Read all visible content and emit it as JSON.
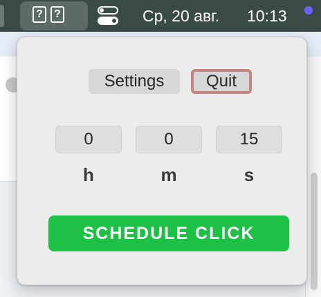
{
  "menubar": {
    "app_icon_glyph": "?",
    "date": "Ср, 20 авг.",
    "time": "10:13",
    "control_center_icon": "toggle-switches-icon",
    "notification_dot_color": "#6b63ff"
  },
  "popover": {
    "settings_label": "Settings",
    "quit_label": "Quit",
    "hours_value": "0",
    "minutes_value": "0",
    "seconds_value": "15",
    "hours_unit": "h",
    "minutes_unit": "m",
    "seconds_unit": "s",
    "schedule_label": "SCHEDULE CLICK",
    "schedule_color": "#1cc145",
    "quit_focus_ring_color": "#c58583"
  }
}
